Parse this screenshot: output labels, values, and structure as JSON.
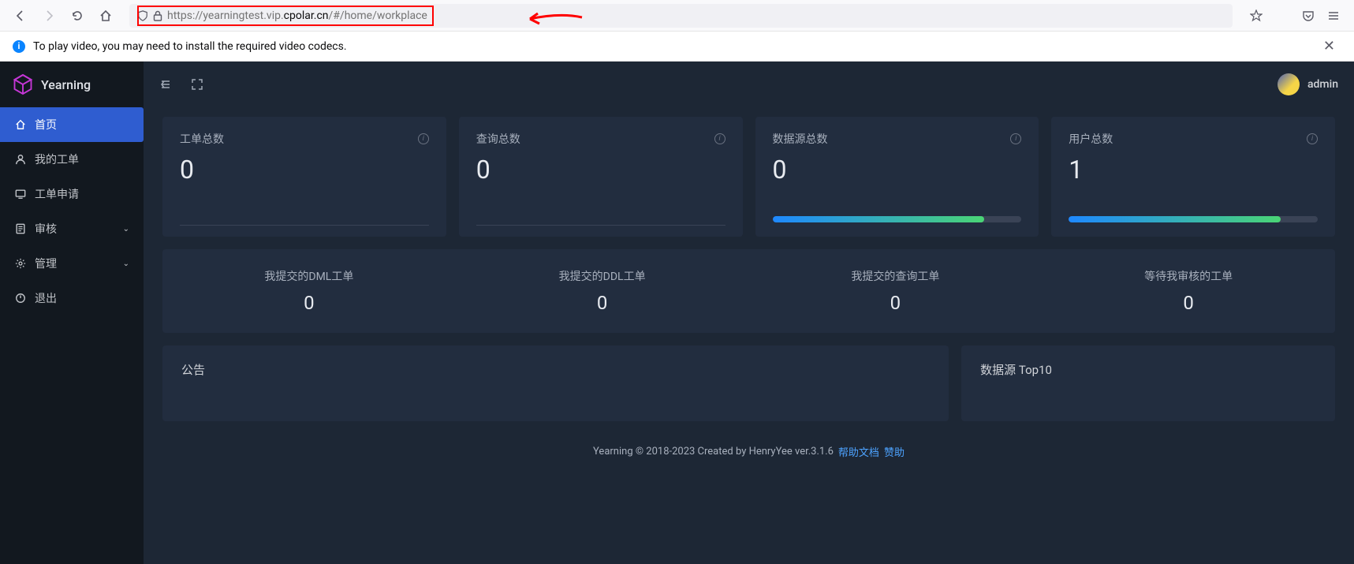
{
  "browser": {
    "url_prefix": "https://yearningtest.vip.",
    "url_domain": "cpolar.cn",
    "url_path": "/#/home/workplace"
  },
  "codec": {
    "message": "To play video, you may need to install the required video codecs."
  },
  "app": {
    "brand": "Yearning",
    "user": "admin"
  },
  "sidebar": {
    "items": [
      {
        "label": "首页"
      },
      {
        "label": "我的工单"
      },
      {
        "label": "工单申请"
      },
      {
        "label": "审核"
      },
      {
        "label": "管理"
      },
      {
        "label": "退出"
      }
    ]
  },
  "stats": [
    {
      "title": "工单总数",
      "value": "0",
      "hasProgress": false
    },
    {
      "title": "查询总数",
      "value": "0",
      "hasProgress": false
    },
    {
      "title": "数据源总数",
      "value": "0",
      "hasProgress": true
    },
    {
      "title": "用户总数",
      "value": "1",
      "hasProgress": true
    }
  ],
  "substats": [
    {
      "label": "我提交的DML工单",
      "value": "0"
    },
    {
      "label": "我提交的DDL工单",
      "value": "0"
    },
    {
      "label": "我提交的查询工单",
      "value": "0"
    },
    {
      "label": "等待我审核的工单",
      "value": "0"
    }
  ],
  "panels": {
    "announcement": "公告",
    "top_sources": "数据源 Top10"
  },
  "footer": {
    "copyright": "Yearning © 2018-2023 Created by HenryYee ver.3.1.6",
    "help": "帮助文档",
    "donate": "赞助"
  }
}
